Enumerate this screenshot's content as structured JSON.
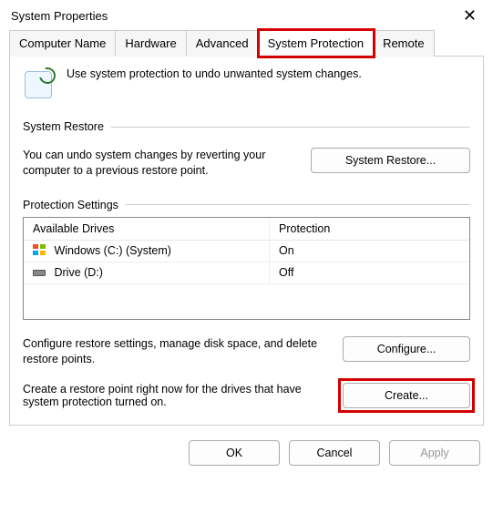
{
  "window": {
    "title": "System Properties"
  },
  "tabs": {
    "computer_name": "Computer Name",
    "hardware": "Hardware",
    "advanced": "Advanced",
    "system_protection": "System Protection",
    "remote": "Remote"
  },
  "intro_text": "Use system protection to undo unwanted system changes.",
  "system_restore": {
    "label": "System Restore",
    "description": "You can undo system changes by reverting your computer to a previous restore point.",
    "button": "System Restore..."
  },
  "protection_settings": {
    "label": "Protection Settings",
    "columns": {
      "drives": "Available Drives",
      "protection": "Protection"
    },
    "rows": [
      {
        "icon": "windows-drive-icon",
        "name": "Windows (C:) (System)",
        "protection": "On"
      },
      {
        "icon": "drive-icon",
        "name": "Drive (D:)",
        "protection": "Off"
      }
    ],
    "configure_text": "Configure restore settings, manage disk space, and delete restore points.",
    "configure_button": "Configure...",
    "create_text": "Create a restore point right now for the drives that have system protection turned on.",
    "create_button": "Create..."
  },
  "footer": {
    "ok": "OK",
    "cancel": "Cancel",
    "apply": "Apply"
  }
}
